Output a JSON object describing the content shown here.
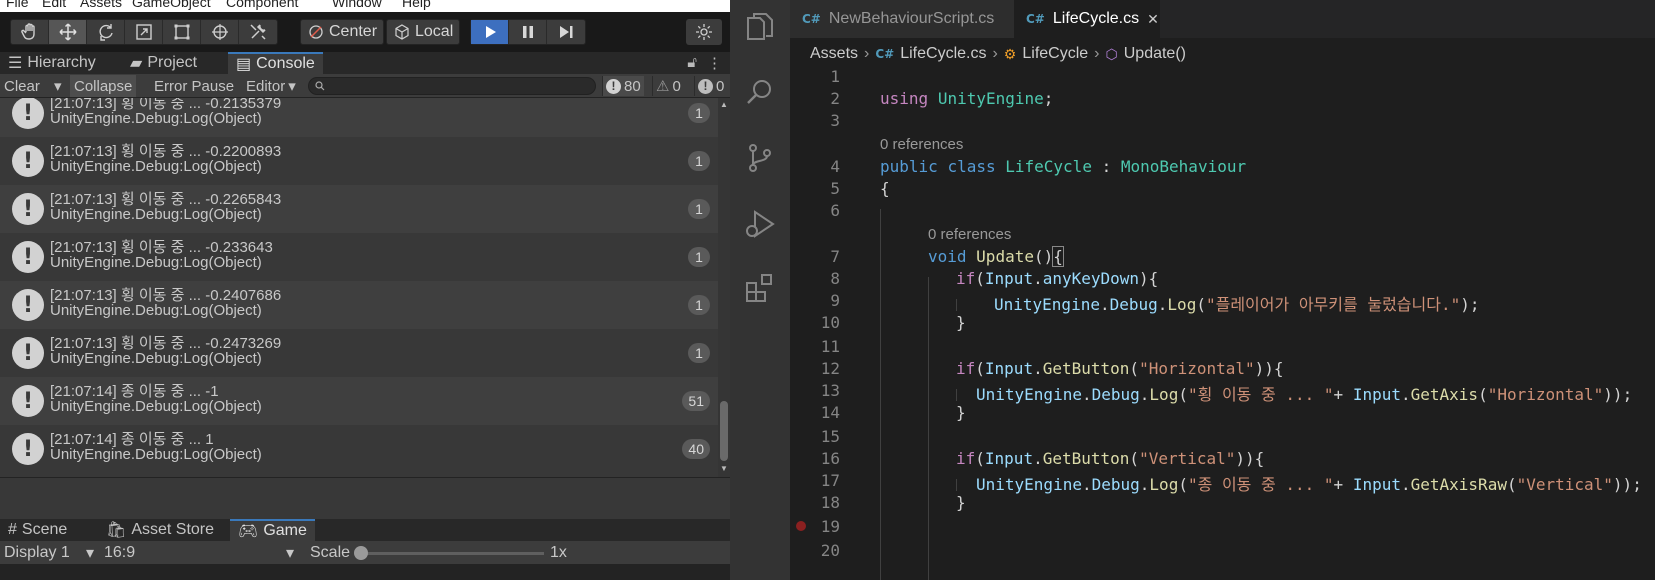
{
  "unity": {
    "menubar": [
      "File",
      "Edit",
      "Assets",
      "GameObject",
      "Component",
      "Window",
      "Help"
    ],
    "toolbar": {
      "tools": [
        "hand-tool",
        "move-tool",
        "rotate-tool",
        "scale-tool",
        "rect-tool",
        "transform-tool",
        "custom-tool"
      ],
      "pivot_label": "Center",
      "space_label": "Local"
    },
    "tabs": [
      "Hierarchy",
      "Project",
      "Console"
    ],
    "console_toolbar": {
      "clear": "Clear",
      "collapse": "Collapse",
      "error_pause": "Error Pause",
      "editor": "Editor",
      "log_count": "80",
      "warning_count": "0",
      "error_count": "0"
    },
    "console_entries": [
      {
        "line1": "[21:07:13] 횡 이동 중 ... -0.2135379",
        "line2": "UnityEngine.Debug:Log(Object)",
        "count": "1"
      },
      {
        "line1": "[21:07:13] 횡 이동 중 ... -0.2200893",
        "line2": "UnityEngine.Debug:Log(Object)",
        "count": "1"
      },
      {
        "line1": "[21:07:13] 횡 이동 중 ... -0.2265843",
        "line2": "UnityEngine.Debug:Log(Object)",
        "count": "1"
      },
      {
        "line1": "[21:07:13] 횡 이동 중 ... -0.233643",
        "line2": "UnityEngine.Debug:Log(Object)",
        "count": "1"
      },
      {
        "line1": "[21:07:13] 횡 이동 중 ... -0.2407686",
        "line2": "UnityEngine.Debug:Log(Object)",
        "count": "1"
      },
      {
        "line1": "[21:07:13] 횡 이동 중 ... -0.2473269",
        "line2": "UnityEngine.Debug:Log(Object)",
        "count": "1"
      },
      {
        "line1": "[21:07:14] 종 이동 중 ... -1",
        "line2": "UnityEngine.Debug:Log(Object)",
        "count": "51"
      },
      {
        "line1": "[21:07:14] 종 이동 중 ... 1",
        "line2": "UnityEngine.Debug:Log(Object)",
        "count": "40"
      }
    ],
    "bottom_tabs": [
      "Scene",
      "Asset Store",
      "Game"
    ],
    "game_toolbar": {
      "display": "Display 1",
      "aspect": "16:9",
      "scale_label": "Scale",
      "scale_value": "1x"
    }
  },
  "vscode": {
    "tabs": [
      {
        "label": "NewBehaviourScript.cs",
        "active": false
      },
      {
        "label": "LifeCycle.cs",
        "active": true
      }
    ],
    "tab_close": "✕",
    "file_badge": "C#",
    "breadcrumbs": [
      "Assets",
      "LifeCycle.cs",
      "LifeCycle",
      "Update()"
    ],
    "codelens": [
      "0 references",
      "0 references"
    ],
    "line_numbers": [
      "1",
      "2",
      "3",
      "4",
      "5",
      "6",
      "7",
      "8",
      "9",
      "10",
      "11",
      "12",
      "13",
      "14",
      "15",
      "16",
      "17",
      "18",
      "19",
      "20"
    ],
    "code": {
      "l2_kw": "using",
      "l2_ns": "UnityEngine",
      "semicolon": ";",
      "l4_public": "public",
      "l4_class": "class",
      "l4_name": "LifeCycle",
      "l4_colon": ":",
      "l4_base": "MonoBehaviour",
      "open_brace": "{",
      "close_brace": "}",
      "l7_void": "void",
      "l7_fn": "Update",
      "l7_parens": "()",
      "if_kw": "if",
      "paren_open": "(",
      "paren_close": ")",
      "paren_close_brace": "){",
      "paren_close2_brace": ")){",
      "dot": ".",
      "input": "Input",
      "anykeydown": "anyKeyDown",
      "unityengine": "UnityEngine",
      "debug": "Debug",
      "log": "Log",
      "l9_str": "\"플레이어가 아무키를 눌렀습니다.\"",
      "getbutton": "GetButton",
      "horizontal_str": "\"Horizontal\"",
      "vertical_str": "\"Vertical\"",
      "l13_str": "\"횡 이동 중 ... \"",
      "l17_str": "\"종 이동 중 ... \"",
      "plus": "+ ",
      "getaxis": "GetAxis",
      "getaxisraw": "GetAxisRaw",
      "end_call": "));"
    }
  }
}
